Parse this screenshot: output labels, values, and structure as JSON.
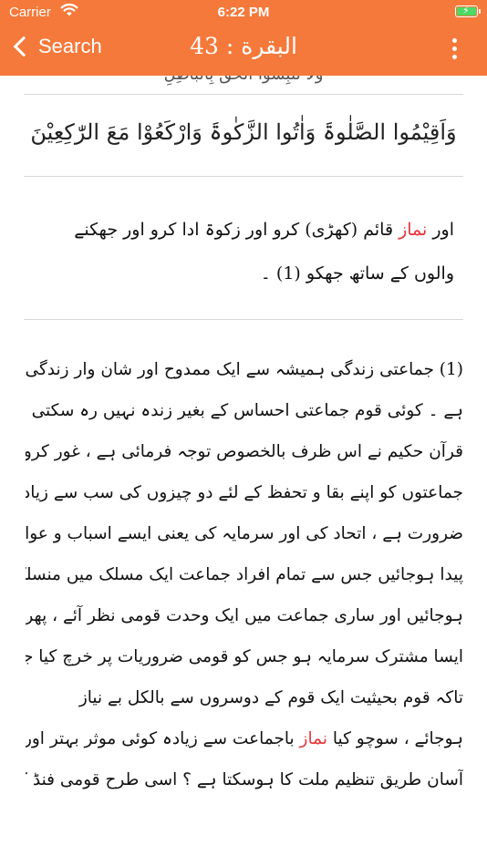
{
  "status_bar": {
    "carrier": "Carrier",
    "time": "6:22 PM",
    "battery_color": "#4cd964"
  },
  "nav": {
    "back_label": "Search",
    "title": "البقرة : 43",
    "accent_color": "#f5793a"
  },
  "verse": {
    "previous_line": "وَلَا تَلْبِسُوا الْحَقَّ بِالْبَاطِلِ",
    "arabic": "وَاَقِیْمُوا الصَّلٰوۃَ وَاٰتُوا الزَّکٰوۃَ وَارْکَعُوْا مَعَ الرّٰکِعِیْنَ",
    "translation_before": "اور ",
    "translation_highlight": "نماز",
    "translation_after": " قائم (کھڑی) کرو اور زکوۃ ادا کرو اور جھکنے والوں کے ساتھ جھکو (1) ۔"
  },
  "commentary": {
    "lines": [
      "(1) جماعتی زندگی ہمیشہ سے ایک ممدوح اور شان وار زندگی رہی",
      "ہے ۔ کوئی قوم جماعتی احساس کے بغیر زندہ نہیں رہ سکتی ،",
      "قرآن حکیم نے اس ظرف بالخصوص توجہ فرمائی ہے ، غور کرو ،",
      "جماعتوں کو اپنے بقا و تحفظ کے لئے دو چیزوں کی سب سے زیادہ",
      "ضرورت ہے ، اتحاد کی اور سرمایہ کی یعنی ایسے اسباب و عوامل",
      "پیدا ہوجائیں جس سے تمام افراد جماعت ایک مسلک میں منسلک",
      "ہوجائیں اور ساری جماعت میں ایک وحدت قومی نظر آئے ، پھر",
      "ایسا مشترک سرمایہ ہو جس کو قومی ضروریات پر خرچ کیا جاسکے ،",
      "تاکہ قوم بحیثیت ایک قوم کے دوسروں سے بالکل بے نیاز"
    ],
    "line_10_before": "ہوجائے ، سوچو کیا ",
    "line_10_highlight": "نماز",
    "line_10_after": " باجماعت سے زیادہ کوئی موثر بہتر اور",
    "line_11": "آسان طریق تنظیم ملت کا ہوسکتا ہے ؟ اسی طرح قومی فنڈ کی"
  },
  "colors": {
    "highlight": "#e8323a"
  }
}
